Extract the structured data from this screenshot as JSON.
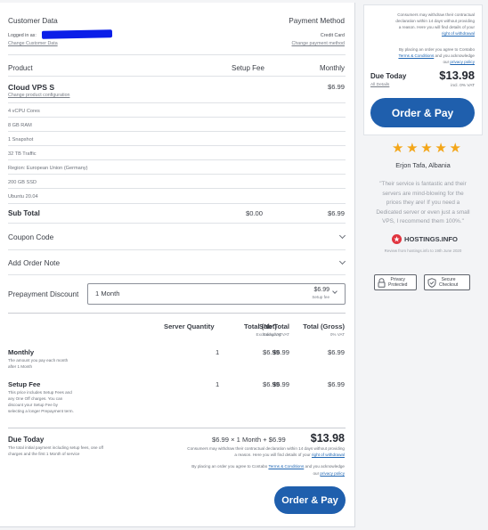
{
  "customer": {
    "heading": "Customer Data",
    "logged_in_label": "Logged in as:",
    "change_link": "Change Customer Data"
  },
  "payment": {
    "heading": "Payment Method",
    "method": "Credit Card",
    "change_link": "Change payment method"
  },
  "product_table": {
    "col_product": "Product",
    "col_setup_fee": "Setup Fee",
    "col_monthly": "Monthly"
  },
  "product": {
    "name": "Cloud VPS S",
    "monthly": "$6.99",
    "configure_link": "Change product configuration",
    "features": [
      "4 vCPU Cores",
      "8 GB RAM",
      "1 Snapshot",
      "32 TB Traffic",
      "Region: European Union (Germany)",
      "200 GB SSD",
      "Ubuntu 20.04"
    ]
  },
  "subtotal": {
    "label": "Sub Total",
    "setup": "$0.00",
    "monthly": "$6.99"
  },
  "coupon": {
    "label": "Coupon Code"
  },
  "order_note": {
    "label": "Add Order Note"
  },
  "prepayment": {
    "label": "Prepayment Discount",
    "selected": "1 Month",
    "price": "$6.99",
    "price_note": "Setup fee"
  },
  "summary": {
    "headers": [
      {
        "title": "Sub Total",
        "sub": "Excluding VAT"
      },
      {
        "title": "Server Quantity",
        "sub": ""
      },
      {
        "title": "Total (Net)",
        "sub": "Excluding VAT"
      },
      {
        "title": "Total (Gross)",
        "sub": "0% VAT"
      }
    ],
    "rows": [
      {
        "title": "Monthly",
        "desc": [
          "The amount you pay each month",
          "after 1 Month"
        ],
        "subtotal": "$6.99",
        "quantity": "1",
        "net": "$6.99",
        "gross": "$6.99"
      },
      {
        "title": "Setup Fee",
        "desc": [
          "This price includes Setup Fees and",
          "any One Off charges. You can",
          "discount your Setup Fee by",
          "selecting a longer Prepayment term."
        ],
        "subtotal": "$6.99",
        "quantity": "1",
        "net": "$6.99",
        "gross": "$6.99"
      }
    ]
  },
  "due": {
    "label": "Due Today",
    "desc": [
      "The total initial payment including setup fees, one off",
      "charges and the first 1 Month of service"
    ],
    "formula": "$6.99 × 1 Month + $6.99",
    "total": "$13.98",
    "withdraw_lines": [
      "Consumers may withdraw their contractual declaration within 14 days without providing",
      "a reason. Here you will find details of your"
    ],
    "withdraw_link": "right of withdrawal",
    "agree_text": "By placing an order you agree to Contabo",
    "terms_link": "Terms & Conditions",
    "agree_text2": "and you acknowledge",
    "our": "our",
    "privacy_link": "privacy policy",
    "button": "Order & Pay"
  },
  "sidebar": {
    "withdraw_lines": [
      "Consumers may withdraw their contractual",
      "declaration within 14 days without providing",
      "a reason. Here you will find details of your"
    ],
    "withdraw_link": "right of withdrawal",
    "agree_text": "By placing an order you agree to Contabo",
    "terms_link": "Terms & Conditions",
    "agree_text2": "and you acknowledge",
    "our": "our",
    "privacy_link": "privacy policy",
    "due_label": "Due Today",
    "due_total": "$13.98",
    "all_details_link": "All Details",
    "vat_note": "incl. 0% VAT",
    "button": "Order & Pay"
  },
  "review": {
    "rating": 5,
    "author": "Erjon Tafa, Albania",
    "quote_lines": [
      "\"Their service is fantastic and their",
      "servers are mind-blowing for the",
      "prices they are! If you need a",
      "Dedicated server or even just a small",
      "VPS, I recommend them 100%.\""
    ],
    "brand": "HOSTINGS.INFO",
    "source": "Review from hostings.info to 19th June 2020"
  },
  "badges": {
    "privacy": [
      "Privacy",
      "Protected"
    ],
    "secure": [
      "Secure",
      "Checkout"
    ]
  },
  "colors": {
    "accent": "#1f5fad",
    "link": "#1f66b3",
    "star": "#f3a619",
    "redaction": "#0b1ee8"
  }
}
